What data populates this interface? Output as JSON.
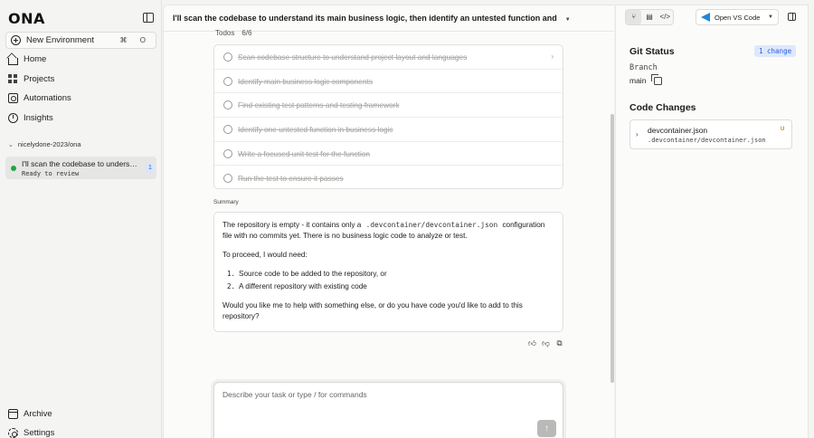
{
  "app": {
    "logo": "ONA"
  },
  "sidebar": {
    "new_env": {
      "label": "New Environment",
      "shortcut": "⌘ O"
    },
    "nav": [
      {
        "label": "Home",
        "icon": "home-icon"
      },
      {
        "label": "Projects",
        "icon": "grid-icon"
      },
      {
        "label": "Automations",
        "icon": "automation-icon"
      },
      {
        "label": "Insights",
        "icon": "insights-icon"
      }
    ],
    "repo": "nicelydone-2023/ona",
    "session": {
      "title": "I'll scan the codebase to understand its main business logic, then identify an untested function and",
      "status": "Ready to review",
      "count": "1",
      "status_color": "#22a447"
    },
    "archive": "Archive",
    "settings": "Settings"
  },
  "main": {
    "task_title": "I'll scan the codebase to understand its main business logic, then identify an untested function and",
    "todos_label": "Todos",
    "todos_count": "6/6",
    "todos": [
      "Scan codebase structure to understand project layout and languages",
      "Identify main business logic components",
      "Find existing test patterns and testing framework",
      "Identify one untested function in business logic",
      "Write a focused unit test for the function",
      "Run the test to ensure it passes"
    ],
    "summary_label": "Summary",
    "summary": {
      "p1_before": "The repository is empty - it contains only a",
      "p1_code": ".devcontainer/devcontainer.json",
      "p1_after": "configuration file with no commits yet. There is no business logic code to analyze or test.",
      "p2": "To proceed, I would need:",
      "list": [
        {
          "n": "1.",
          "text": "Source code to be added to the repository, or"
        },
        {
          "n": "2.",
          "text": "A different repository with existing code"
        }
      ],
      "p3": "Would you like me to help with something else, or do you have code you'd like to add to this repository?"
    },
    "composer_placeholder": "Describe your task or type / for commands"
  },
  "right": {
    "vscode_label": "Open VS Code",
    "git_status_title": "Git Status",
    "change_badge": "1 change",
    "branch_label": "Branch",
    "branch_value": "main",
    "code_changes_title": "Code Changes",
    "file": {
      "name": "devcontainer.json",
      "path": ".devcontainer/devcontainer.json",
      "status": "U"
    }
  }
}
